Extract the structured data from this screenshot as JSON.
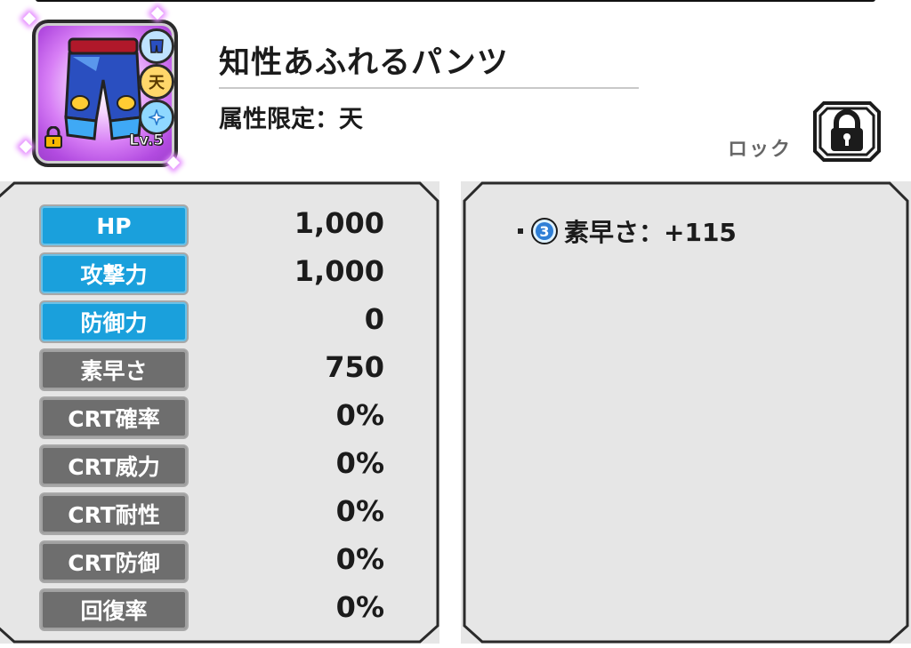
{
  "item": {
    "name": "知性あふれるパンツ",
    "attribute_limit": "属性限定：天",
    "level": "Lv.5",
    "badge_type": "pants-icon",
    "badge_attr": "天",
    "badge_skill": "sparkle-icon"
  },
  "lock": {
    "label": "ロック",
    "icon": "padlock-icon"
  },
  "stats": [
    {
      "label": "HP",
      "value": "1,000",
      "style": "blue"
    },
    {
      "label": "攻撃力",
      "value": "1,000",
      "style": "blue"
    },
    {
      "label": "防御力",
      "value": "0",
      "style": "blue"
    },
    {
      "label": "素早さ",
      "value": "750",
      "style": "gray"
    },
    {
      "label": "CRT確率",
      "value": "0%",
      "style": "gray"
    },
    {
      "label": "CRT威力",
      "value": "0%",
      "style": "gray"
    },
    {
      "label": "CRT耐性",
      "value": "0%",
      "style": "gray"
    },
    {
      "label": "CRT防御",
      "value": "0%",
      "style": "gray"
    },
    {
      "label": "回復率",
      "value": "0%",
      "style": "gray"
    }
  ],
  "effects": [
    {
      "rank": "3",
      "text": "素早さ：+115"
    }
  ],
  "colors": {
    "blue_label": "#1aa0dc",
    "gray_label": "#6e6e6e",
    "panel": "#e6e6e6"
  }
}
